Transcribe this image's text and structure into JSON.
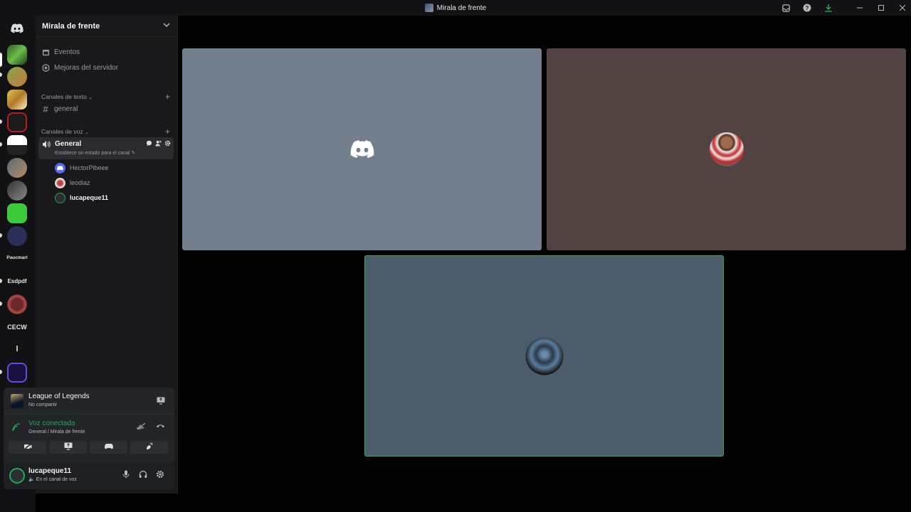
{
  "window": {
    "title": "Mirala de frente"
  },
  "rail": {
    "servers": [
      {
        "name": "server-1"
      },
      {
        "name": "server-2"
      },
      {
        "name": "server-3"
      },
      {
        "name": "server-4"
      },
      {
        "name": "server-5"
      },
      {
        "name": "server-6"
      },
      {
        "name": "server-7"
      },
      {
        "name": "server-8"
      },
      {
        "name": "server-9"
      }
    ],
    "text_servers": [
      "Paucmarl",
      "Esdpdf",
      "CECW",
      "l"
    ]
  },
  "sidebar": {
    "guild_name": "Mirala de frente",
    "nav": {
      "events": "Eventos",
      "boosts": "Mejoras del servidor"
    },
    "text_category": "Canales de texto",
    "text_channel": "general",
    "voice_category": "Canales de voz",
    "voice_channel": {
      "name": "General",
      "status": "Establece un estado para el canal"
    },
    "voice_users": [
      "HectorPibeee",
      "leodiaz",
      "lucapeque11"
    ]
  },
  "activity": {
    "game": "League of Legends",
    "sub": "No compartir"
  },
  "voice_connection": {
    "title": "Voz conectada",
    "sub": "General / Mirala de frente"
  },
  "user": {
    "name": "lucapeque11",
    "status": "En el canal de voz"
  },
  "colors": {
    "tile_1": "#747f8d",
    "tile_2": "#524242",
    "tile_3": "#4c5c6a",
    "speaking": "#3ba55d",
    "online": "#23a55a"
  },
  "icons": [
    "discord-icon",
    "calendar-icon",
    "boost-icon",
    "hash-icon",
    "speaker-icon",
    "mic-icon",
    "headphones-icon",
    "gear-icon",
    "signal-icon",
    "hangup-icon",
    "screen-share-icon",
    "camera-off-icon",
    "activity-icon",
    "soundboard-icon",
    "inbox-icon",
    "help-icon",
    "download-icon"
  ]
}
